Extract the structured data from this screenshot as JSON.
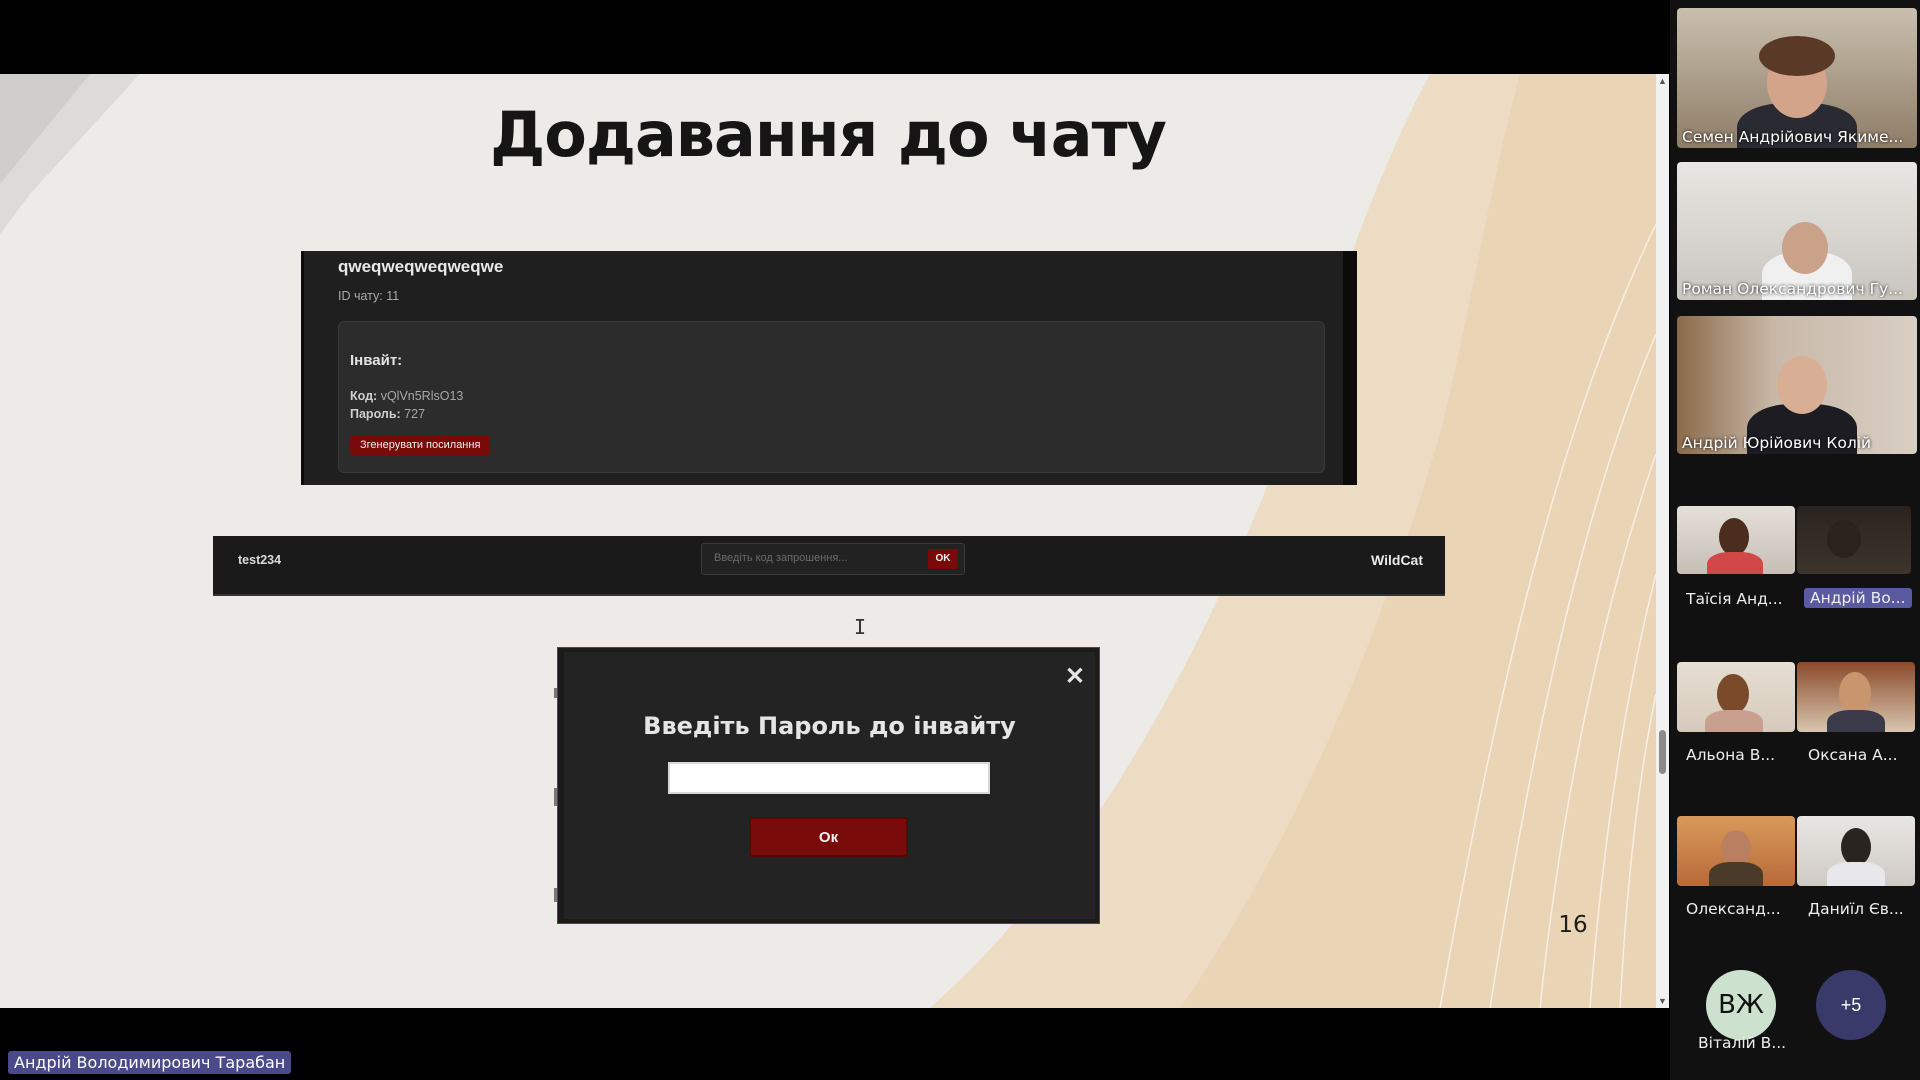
{
  "slide": {
    "title": "Додавання до чату",
    "number": "16"
  },
  "chat_panel": {
    "chat_name": "qweqweqweqweqwe",
    "chat_id": "ID чату: 11",
    "invite_heading": "Інвайт:",
    "code_label": "Код:",
    "code_value": "vQlVn5RlsO13",
    "password_label": "Пароль:",
    "password_value": "727",
    "generate_button": "Згенерувати посилання"
  },
  "header_bar": {
    "username": "test234",
    "invite_placeholder": "Введіть код запрошення...",
    "ok_button": "OK",
    "brand": "WildCat"
  },
  "modal": {
    "close_symbol": "✕",
    "heading": "Введіть Пароль до інвайту",
    "ok_button": "Ок"
  },
  "presenter": {
    "name": "Андрій Володимирович Тарабан"
  },
  "participants": [
    {
      "name": "Семен Андрійович Якиме..."
    },
    {
      "name": "Роман Олександрович Гу..."
    },
    {
      "name": "Андрій Юрійович Колій"
    },
    {
      "name": "Таїсія Анд..."
    },
    {
      "name": "Андрій Во..."
    },
    {
      "name": "Альона В..."
    },
    {
      "name": "Оксана А..."
    },
    {
      "name": "Олександ..."
    },
    {
      "name": "Даниїл Єв..."
    },
    {
      "name": "Віталій В...",
      "initials": "ВЖ"
    },
    {
      "overflow": "+5"
    }
  ]
}
